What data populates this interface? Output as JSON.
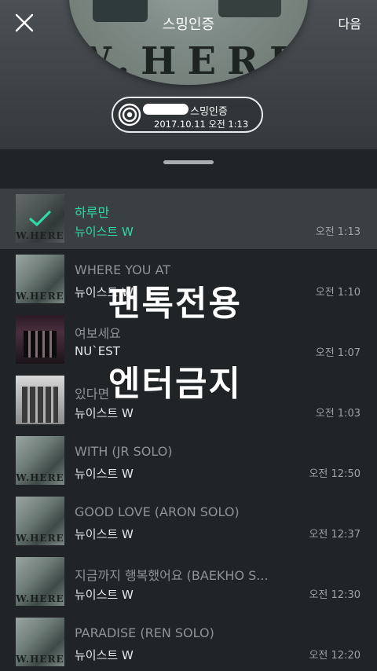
{
  "header": {
    "title": "스밍인증",
    "next_label": "다음",
    "album_art_text": "W.HERE"
  },
  "auth_badge": {
    "line1": "스밍인증",
    "line2": "2017.10.11 오전 1:13"
  },
  "watermark": {
    "line1": "팬톡전용",
    "line2": "엔터금지"
  },
  "songs": [
    {
      "title": "하루만",
      "artist": "뉴이스트 W",
      "time": "오전 1:13",
      "selected": true,
      "art": "where-art"
    },
    {
      "title": "WHERE YOU AT",
      "artist": "뉴이스트 W",
      "time": "오전 1:10",
      "selected": false,
      "art": "where-art"
    },
    {
      "title": "여보세요",
      "artist": "NU`EST",
      "time": "오전 1:07",
      "selected": false,
      "art": "stage-art"
    },
    {
      "title": "있다면",
      "artist": "뉴이스트 W",
      "time": "오전 1:03",
      "selected": false,
      "art": "gray-art"
    },
    {
      "title": "WITH (JR SOLO)",
      "artist": "뉴이스트 W",
      "time": "오전 12:50",
      "selected": false,
      "art": "where-art"
    },
    {
      "title": "GOOD LOVE (ARON SOLO)",
      "artist": "뉴이스트 W",
      "time": "오전 12:37",
      "selected": false,
      "art": "where-art"
    },
    {
      "title": "지금까지 행복했어요 (BAEKHO S...",
      "artist": "뉴이스트 W",
      "time": "오전 12:30",
      "selected": false,
      "art": "where-art"
    },
    {
      "title": "PARADISE (REN SOLO)",
      "artist": "뉴이스트 W",
      "time": "오전 12:20",
      "selected": false,
      "art": "where-art"
    }
  ],
  "colors": {
    "accent": "#2fd9a8",
    "background": "#202427",
    "selected_row": "#3a3f42"
  },
  "icons": {
    "close": "close-icon",
    "check": "check-icon",
    "logo": "concentric-circles-icon"
  }
}
